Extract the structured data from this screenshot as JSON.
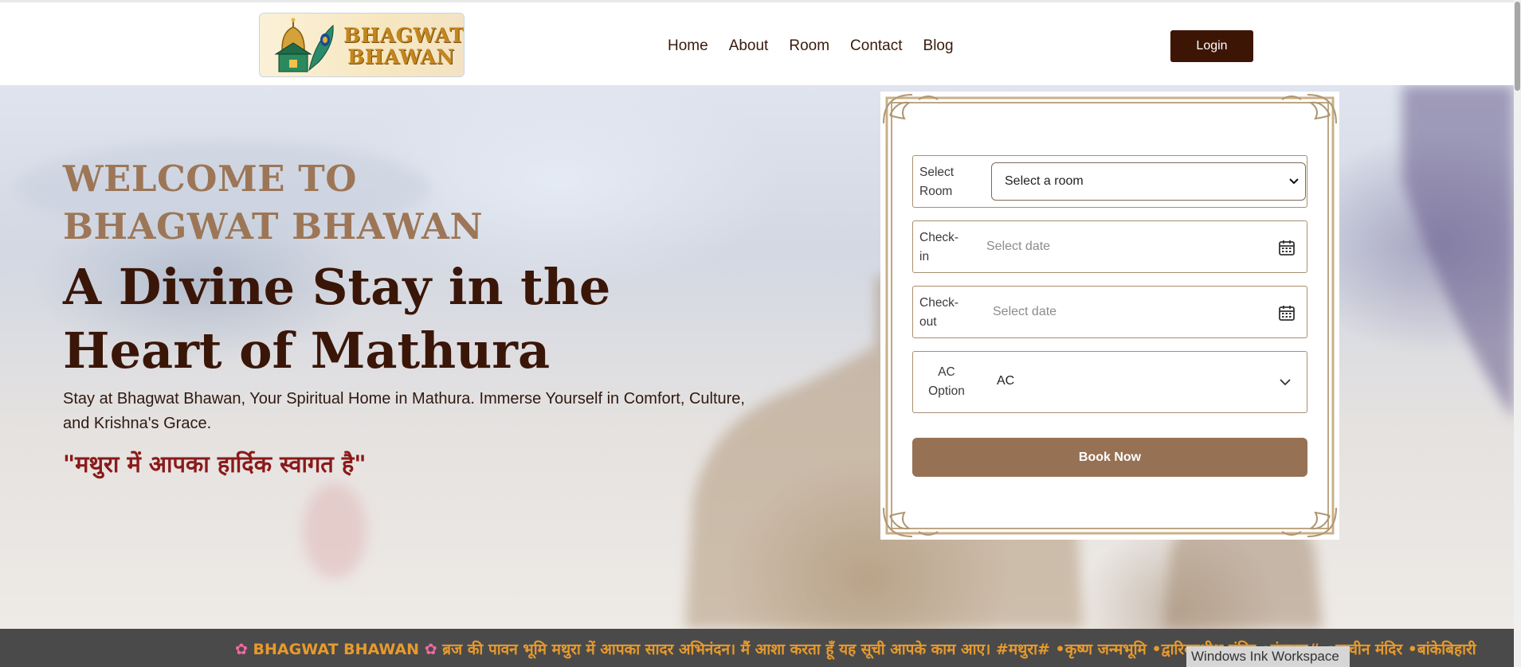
{
  "header": {
    "logo_text_line1": "BHAGWAT",
    "logo_text_line2": "BHAWAN",
    "nav": [
      "Home",
      "About",
      "Room",
      "Contact",
      "Blog"
    ],
    "login_label": "Login"
  },
  "hero": {
    "welcome_line1": "WELCOME TO",
    "welcome_line2": "BHAGWAT BHAWAN",
    "tagline": "A Divine Stay in the Heart of Mathura",
    "description": "Stay at Bhagwat Bhawan, Your Spiritual Home in Mathura. Immerse Yourself in Comfort, Culture, and Krishna's Grace.",
    "hindi_greeting": "\"मथुरा में आपका हार्दिक स्वागत है\""
  },
  "booking": {
    "room_label_1": "Select",
    "room_label_2": "Room",
    "room_select_value": "Select a room",
    "checkin_label_1": "Check-",
    "checkin_label_2": "in",
    "checkin_placeholder": "Select date",
    "checkout_label_1": "Check-",
    "checkout_label_2": "out",
    "checkout_placeholder": "Select date",
    "ac_label_1": "AC",
    "ac_label_2": "Option",
    "ac_value": "AC",
    "book_label": "Book Now"
  },
  "ticker": {
    "brand": "BHAGWAT BHAWAN",
    "message": "ब्रज की पावन भूमि मथुरा में आपका सादर अभिनंदन। मैं आशा करता हूँ यह सूची आपके काम आए। #मथुरा# •कृष्ण जन्मभूमि •द्वारिकाधीश मंदिर •वृंदावन# •प्राचीन मंदिर •बांकेबिहारी"
  },
  "overlay": {
    "ink_workspace": "Windows Ink Workspace"
  },
  "colors": {
    "brand_dark": "#3d1505",
    "accent_brown": "#977154",
    "welcome_color": "#9c7656",
    "hindi_red": "#8a1a1a",
    "ticker_orange": "#e89a2c"
  },
  "icons": [
    "calendar-icon",
    "chevron-down-icon",
    "flower-icon",
    "temple-logo-icon",
    "peacock-feather-icon"
  ]
}
